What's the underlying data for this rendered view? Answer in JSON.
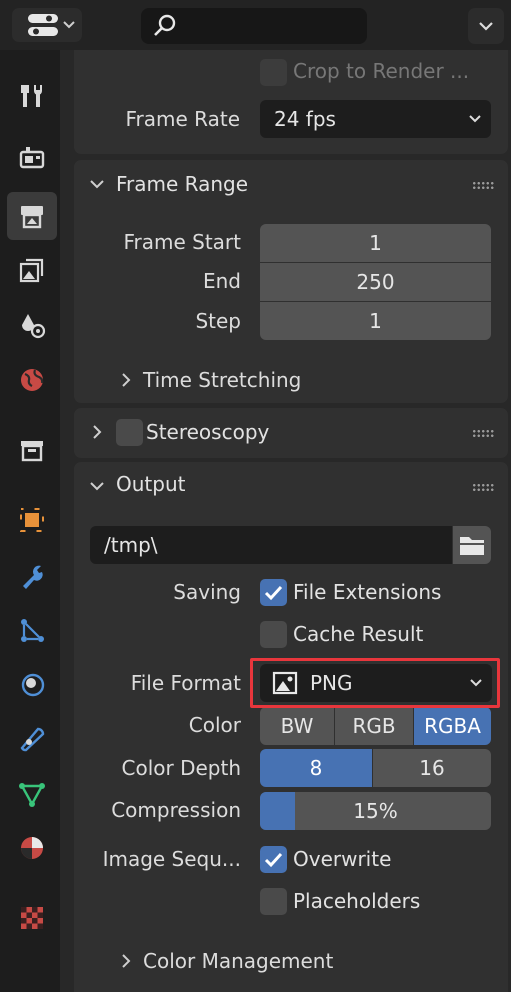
{
  "header": {
    "editor_type_icon": "properties-editor-icon",
    "search_icon": "search-icon",
    "search": {
      "value": "",
      "placeholder": ""
    },
    "options_icon": "chevron-down-icon"
  },
  "tabs": [
    {
      "name": "tool",
      "icon": "tool-icon"
    },
    {
      "name": "render",
      "icon": "render-icon"
    },
    {
      "name": "output",
      "icon": "output-icon",
      "active": true
    },
    {
      "name": "view-layer",
      "icon": "view-layer-icon"
    },
    {
      "name": "scene",
      "icon": "scene-icon"
    },
    {
      "name": "world",
      "icon": "world-icon"
    },
    {
      "name": "collection",
      "icon": "collection-icon"
    },
    {
      "name": "object",
      "icon": "object-icon"
    },
    {
      "name": "modifiers",
      "icon": "wrench-icon"
    },
    {
      "name": "particles",
      "icon": "particles-icon"
    },
    {
      "name": "physics",
      "icon": "physics-icon"
    },
    {
      "name": "constraints",
      "icon": "constraints-icon"
    },
    {
      "name": "data",
      "icon": "mesh-data-icon"
    },
    {
      "name": "material",
      "icon": "material-icon"
    },
    {
      "name": "texture",
      "icon": "texture-icon"
    }
  ],
  "format_panel": {
    "crop_to_render": "Crop to Render ...",
    "frame_rate_label": "Frame Rate",
    "frame_rate_value": "24 fps"
  },
  "frame_range": {
    "title": "Frame Range",
    "start_label": "Frame Start",
    "start_value": "1",
    "end_label": "End",
    "end_value": "250",
    "step_label": "Step",
    "step_value": "1",
    "time_stretching": "Time Stretching"
  },
  "stereoscopy": {
    "title": "Stereoscopy"
  },
  "output": {
    "title": "Output",
    "path": "/tmp\\",
    "saving_label": "Saving",
    "file_extensions": "File Extensions",
    "cache_result": "Cache Result",
    "file_format_label": "File Format",
    "file_format_value": "PNG",
    "color_label": "Color",
    "color_options": [
      "BW",
      "RGB",
      "RGBA"
    ],
    "color_selected": "RGBA",
    "color_depth_label": "Color Depth",
    "color_depth_options": [
      "8",
      "16"
    ],
    "color_depth_selected": "8",
    "compression_label": "Compression",
    "compression_value": "15%",
    "compression_fraction": 0.15,
    "image_sequence_label": "Image Sequ...",
    "overwrite": "Overwrite",
    "placeholders": "Placeholders",
    "color_management": "Color Management"
  },
  "colors": {
    "accent": "#4772b3",
    "highlight_box": "#e8363c"
  }
}
